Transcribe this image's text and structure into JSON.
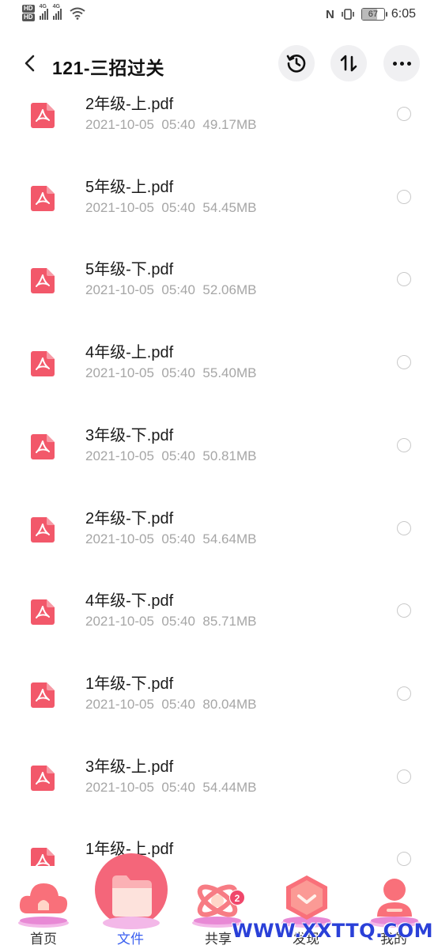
{
  "status_bar": {
    "network_badge_1": "HD",
    "network_badge_2": "HD",
    "signal_1_label": "4G",
    "signal_2_label": "4G",
    "battery": "67",
    "time": "6:05"
  },
  "header": {
    "title": "121-三招过关"
  },
  "files": [
    {
      "name": "2年级-上.pdf",
      "date": "2021-10-05",
      "time": "05:40",
      "size": "49.17MB"
    },
    {
      "name": "5年级-上.pdf",
      "date": "2021-10-05",
      "time": "05:40",
      "size": "54.45MB"
    },
    {
      "name": "5年级-下.pdf",
      "date": "2021-10-05",
      "time": "05:40",
      "size": "52.06MB"
    },
    {
      "name": "4年级-上.pdf",
      "date": "2021-10-05",
      "time": "05:40",
      "size": "55.40MB"
    },
    {
      "name": "3年级-下.pdf",
      "date": "2021-10-05",
      "time": "05:40",
      "size": "50.81MB"
    },
    {
      "name": "2年级-下.pdf",
      "date": "2021-10-05",
      "time": "05:40",
      "size": "54.64MB"
    },
    {
      "name": "4年级-下.pdf",
      "date": "2021-10-05",
      "time": "05:40",
      "size": "85.71MB"
    },
    {
      "name": "1年级-下.pdf",
      "date": "2021-10-05",
      "time": "05:40",
      "size": "80.04MB"
    },
    {
      "name": "3年级-上.pdf",
      "date": "2021-10-05",
      "time": "05:40",
      "size": "54.44MB"
    },
    {
      "name": "1年级-上.pdf",
      "date": "",
      "time": "",
      "size": ""
    }
  ],
  "nav": {
    "home": "首页",
    "files": "文件",
    "share": "共享",
    "discover": "发现",
    "me": "我的",
    "share_badge": "2"
  },
  "watermark": "WWW.XXTTQ.COM",
  "colors": {
    "pdf_icon": "#f2586a",
    "active_nav": "#3a5ff0",
    "badge": "#f0476b"
  }
}
